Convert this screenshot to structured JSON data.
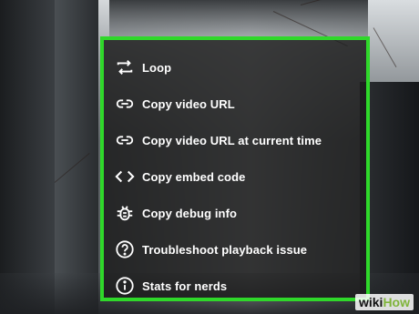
{
  "menu": {
    "accent_color": "#2fd82a",
    "items": [
      {
        "label": "Loop",
        "icon": "loop-icon"
      },
      {
        "label": "Copy video URL",
        "icon": "link-icon"
      },
      {
        "label": "Copy video URL at current time",
        "icon": "link-icon"
      },
      {
        "label": "Copy embed code",
        "icon": "code-icon"
      },
      {
        "label": "Copy debug info",
        "icon": "bug-icon"
      },
      {
        "label": "Troubleshoot playback issue",
        "icon": "help-circle-icon"
      },
      {
        "label": "Stats for nerds",
        "icon": "info-icon"
      }
    ]
  },
  "watermark": {
    "prefix": "wiki",
    "suffix": "How"
  }
}
